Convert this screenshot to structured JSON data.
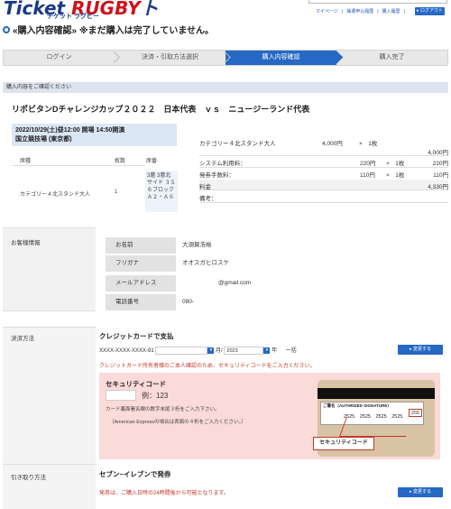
{
  "header": {
    "logo_text_1": "Ticket ",
    "logo_text_2": "RUGBY",
    "logo_text_3": "ト",
    "logo_sub": "チケット ラグビー",
    "links": [
      "マイページ",
      "抽選申込履歴",
      "購入履歴"
    ],
    "logout": "▸ ログアウト",
    "brand_color": "#1a3a8a",
    "accent_color": "#2569c4"
  },
  "page_title": "«購入内容確認» ※まだ購入は完了していません。",
  "steps": [
    "ログイン",
    "決済・引取方法選択",
    "購入内容確認",
    "購入完了"
  ],
  "active_step": 2,
  "section_bar": "購入内容をご確認ください",
  "event": {
    "title": "リポビタンDチャレンジカップ２０２２　日本代表　ｖｓ　ニュージーランド代表",
    "datetime": "2022/10/29(土)昼12:00 開場 14:50開演",
    "venue": "国立競技場 (東京都)"
  },
  "ticket_table": {
    "headers": [
      "席種",
      "枚数",
      "席番"
    ],
    "seat_type": "カテゴリー４北スタンド大人",
    "count": "1",
    "seat_no": "3層 3層北サイド ３５６ブロック Ａ２・Ａ６"
  },
  "price": {
    "item_label": "カテゴリー４北スタンド大人",
    "item_price": "4,000円",
    "item_qty": "×　1枚",
    "item_total": "4,000円",
    "sys_label": "システム利用料：",
    "sys_price": "220円",
    "sys_qty": "×　1枚",
    "sys_total": "220円",
    "issue_label": "発券手数料：",
    "issue_price": "110円",
    "issue_qty": "×　1枚",
    "issue_total": "110円",
    "fee_label": "料金",
    "fee_total": "4,330円",
    "note_label": "備考："
  },
  "customer": {
    "section_label": "お客様情報",
    "name_label": "お名前",
    "name_value": "大須賀浩裕",
    "kana_label": "フリガナ",
    "kana_value": "オオスガヒロスケ",
    "email_label": "メールアドレス",
    "email_value": "@gmail.com",
    "phone_label": "電話番号",
    "phone_value": "080-"
  },
  "payment": {
    "section_label": "決済方法",
    "method_title": "クレジットカードで支払",
    "card_number": "XXXX-XXXX-XXXX-81",
    "month_label": "月/",
    "year_value": "2023",
    "year_label": "年",
    "installment": "一括",
    "change_btn": "▸ 変更する",
    "warning": "クレジットカード所有者様のご本人確認のため、セキュリティコードをご入力ください。",
    "sec_title": "セキュリティコード",
    "sec_example": "例：123",
    "sec_note1": "カード裏面署名欄の数字末尾３桁をご入力下さい。",
    "sec_note2": "（American Expressの場合は表面の４桁をご入力ください。）",
    "card_sig_label": "ご署名（AUTHRIZED SIGNATURE）",
    "card_digits": "2525　2525　2525　2525",
    "card_code": "255",
    "callout": "セキュリティコード"
  },
  "pickup": {
    "section_label": "引き取り方法",
    "method_title": "セブン−イレブンで発券",
    "note": "発券は、ご購入日時の24時間後から可能となります。",
    "change_btn": "▸ 変更する"
  }
}
